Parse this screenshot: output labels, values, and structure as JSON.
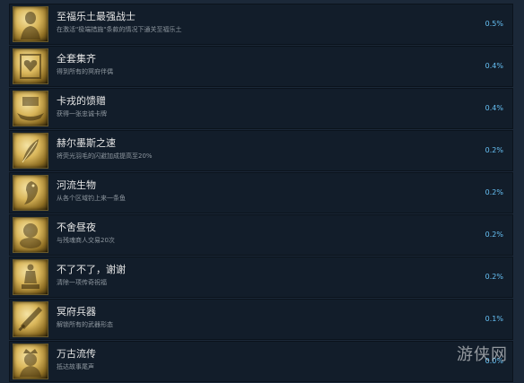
{
  "achievements": [
    {
      "title": "至福乐土最强战士",
      "desc": "在激活\"极端措施\"条款的情况下通关至福乐土",
      "pct": "0.5%",
      "icon": "bust-statue-icon"
    },
    {
      "title": "全套集齐",
      "desc": "得到所有的冥府伴偶",
      "pct": "0.4%",
      "icon": "heart-card-icon"
    },
    {
      "title": "卡戎的馈赠",
      "desc": "获得一张忠诚卡牌",
      "pct": "0.4%",
      "icon": "boat-icon"
    },
    {
      "title": "赫尔墨斯之速",
      "desc": "将荧光羽毛的闪避加成提高至20%",
      "pct": "0.2%",
      "icon": "feather-icon"
    },
    {
      "title": "河流生物",
      "desc": "从各个区域钓上来一条鱼",
      "pct": "0.2%",
      "icon": "fish-icon"
    },
    {
      "title": "不舍昼夜",
      "desc": "与残魂商人交易20次",
      "pct": "0.2%",
      "icon": "merchant-icon"
    },
    {
      "title": "不了不了，谢谢",
      "desc": "清除一项传奇祝福",
      "pct": "0.2%",
      "icon": "figure-statue-icon"
    },
    {
      "title": "冥府兵器",
      "desc": "解锁所有的武器形态",
      "pct": "0.1%",
      "icon": "weapon-icon"
    },
    {
      "title": "万古流传",
      "desc": "抵达故事尾声",
      "pct": "0.0%",
      "icon": "crowned-bust-icon"
    }
  ],
  "watermark": "游侠网",
  "colors": {
    "background": "#1b2838",
    "row": "#121d2a",
    "percent": "#66c0f4",
    "gold": "#d9b65a"
  }
}
